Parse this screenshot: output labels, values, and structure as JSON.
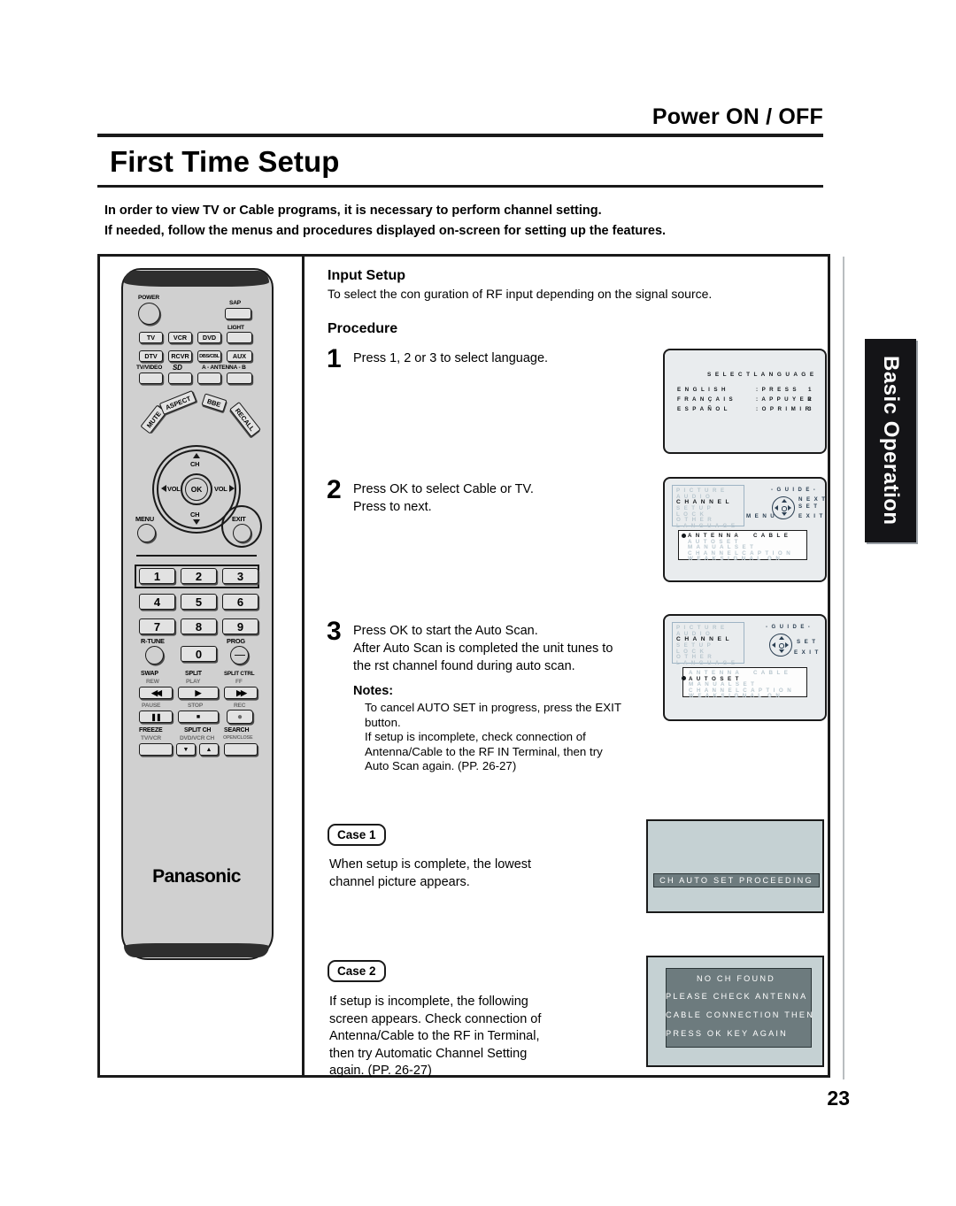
{
  "header": {
    "section_title": "Power ON / OFF",
    "page_title": "First Time Setup",
    "intro_line1": "In order to view TV or Cable programs, it is necessary to perform channel setting.",
    "intro_line2": "If needed, follow the menus and procedures displayed on-screen for setting up the features."
  },
  "side_tab": {
    "label": "Basic Operation"
  },
  "page_number": "23",
  "input_setup": {
    "heading": "Input Setup",
    "description": "To select the con guration of RF input depending on the signal source.",
    "procedure_heading": "Procedure"
  },
  "steps": [
    {
      "number": "1",
      "line1": "Press 1, 2 or 3 to select language."
    },
    {
      "number": "2",
      "line1": "Press OK to select Cable or TV.",
      "line2": "Press    to next."
    },
    {
      "number": "3",
      "line1": "Press OK to start the Auto Scan.",
      "line2": "After Auto Scan is completed the unit tunes to",
      "line3": "the  rst channel found during auto scan.",
      "notes_heading": "Notes:",
      "note1a": "To cancel AUTO SET in progress, press the EXIT",
      "note1b": "button.",
      "note2a": "If setup is incomplete, check connection of",
      "note2b": "Antenna/Cable to the RF IN Terminal, then try",
      "note2c": "Auto Scan again. (PP. 26-27)"
    }
  ],
  "osd_language": {
    "title": "S E L E C T   L A N G U A G E",
    "rows": [
      {
        "lang": "E N G L I S H",
        "action": ": P R E S S",
        "num": "1"
      },
      {
        "lang": "F R A N Ç A I S",
        "action": ": A P P U Y E R",
        "num": "2"
      },
      {
        "lang": "E S P A Ñ O L",
        "action": ": O P R I M I R",
        "num": "3"
      }
    ]
  },
  "osd_menu_2": {
    "menu_items": [
      "P I C T U R E",
      "A U D I O",
      "C H A N N E L",
      "S E T U P",
      "L O C K",
      "O T H E R",
      "L A N G U A G E"
    ],
    "selected_menu": "C H A N N E L",
    "guide_label": "- G U I D E -",
    "guide_next": "N E X T",
    "guide_set": "S E T",
    "guide_menu": "M E N U",
    "guide_exit": "E X I T",
    "sub_items": [
      {
        "label": "A N T E N N A",
        "value": "C A B L E",
        "highlight": true
      },
      {
        "label": "A U T O   S E T",
        "value": "",
        "highlight": false
      },
      {
        "label": "M A N U A L   S E T",
        "value": "",
        "highlight": false
      },
      {
        "label": "C H A N N E L   C A P T I O N",
        "value": "",
        "highlight": false
      },
      {
        "label": "W E A K   S I G N A L",
        "value": "O N",
        "highlight": false
      }
    ]
  },
  "osd_menu_3": {
    "menu_items": [
      "P I C T U R E",
      "A U D I O",
      "C H A N N E L",
      "S E T U P",
      "L O C K",
      "O T H E R",
      "L A N G U A G E"
    ],
    "selected_menu": "C H A N N E L",
    "guide_label": "- G U I D E -",
    "guide_set": "S E T",
    "guide_exit": "E X I T",
    "sub_items": [
      {
        "label": "A N T E N N A",
        "value": "C A B L E",
        "highlight": false
      },
      {
        "label": "A U T O   S E T",
        "value": "",
        "highlight": true
      },
      {
        "label": "M A N U A L   S E T",
        "value": "",
        "highlight": false
      },
      {
        "label": "C H A N N E L   C A P T I O N",
        "value": "",
        "highlight": false
      },
      {
        "label": "W E A K   S I G N A L",
        "value": "O N",
        "highlight": false
      }
    ]
  },
  "case1": {
    "tag": "Case 1",
    "text_line1": "When setup is complete, the lowest",
    "text_line2": "channel picture appears.",
    "screen_message": "CH AUTO SET PROCEEDING"
  },
  "case2": {
    "tag": "Case 2",
    "text_line1": "If setup is incomplete, the following",
    "text_line2": "screen appears. Check connection of",
    "text_line3": "Antenna/Cable to the RF in Terminal,",
    "text_line4": "then try Automatic Channel Setting",
    "text_line5": "again. (PP. 26-27)",
    "screen_lines": [
      "NO CH FOUND",
      "PLEASE CHECK ANTENNA",
      "CABLE CONNECTION THEN",
      "PRESS OK KEY AGAIN"
    ]
  },
  "remote": {
    "brand": "Panasonic",
    "power": "POWER",
    "sap": "SAP",
    "light": "LIGHT",
    "row_device1": [
      "TV",
      "VCR",
      "DVD"
    ],
    "row_device2": [
      "DTV",
      "RCVR",
      "DBS/CBL",
      "AUX"
    ],
    "tv_video": "TV/VIDEO",
    "sd_card": "SD",
    "antenna": "A - ANTENNA - B",
    "aspect": "ASPECT",
    "bbe": "BBE",
    "mute": "MUTE",
    "recall": "RECALL",
    "ch_up": "CH",
    "ch_down": "CH",
    "vol_left": "VOL",
    "vol_right": "VOL",
    "ok": "OK",
    "menu": "MENU",
    "exit": "EXIT",
    "numbers": [
      "1",
      "2",
      "3",
      "4",
      "5",
      "6",
      "7",
      "8",
      "9",
      "0"
    ],
    "r_tune": "R-TUNE",
    "prog": "PROG",
    "swap": "SWAP",
    "rew": "REW",
    "split": "SPLIT",
    "play": "PLAY",
    "split_ctrl": "SPLIT CTRL",
    "ff": "FF",
    "pause": "PAUSE",
    "stop": "STOP",
    "rec": "REC",
    "freeze": "FREEZE",
    "tv_vcr": "TV/VCR",
    "split_ch": "SPLIT CH",
    "dvd_vcr_ch": "DVD/VCR CH",
    "search": "SEARCH",
    "open_close": "OPEN/CLOSE"
  }
}
